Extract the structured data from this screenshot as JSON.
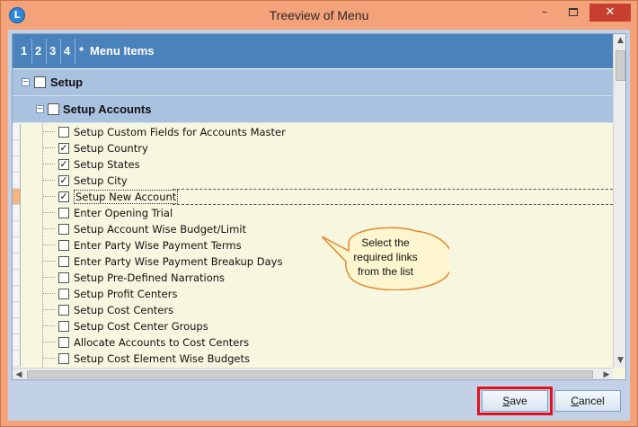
{
  "window": {
    "title": "Treeview of Menu",
    "app_icon": "L",
    "minimize": "–",
    "close": "✕"
  },
  "header": {
    "levels": [
      "1",
      "2",
      "3",
      "4"
    ],
    "star": "*",
    "menu_items": "Menu Items"
  },
  "tree": {
    "root": {
      "label": "Setup",
      "expander": "–"
    },
    "group": {
      "label": "Setup Accounts",
      "expander": "–"
    },
    "items": [
      {
        "label": "Setup Custom Fields for Accounts Master",
        "checked": ""
      },
      {
        "label": "Setup Country",
        "checked": "✓"
      },
      {
        "label": "Setup States",
        "checked": "✓"
      },
      {
        "label": "Setup City",
        "checked": "✓"
      },
      {
        "label": "Setup New Account",
        "checked": "✓"
      },
      {
        "label": "Enter Opening Trial",
        "checked": ""
      },
      {
        "label": "Setup Account Wise Budget/Limit",
        "checked": ""
      },
      {
        "label": "Enter Party Wise Payment Terms",
        "checked": ""
      },
      {
        "label": "Enter Party Wise Payment Breakup Days",
        "checked": ""
      },
      {
        "label": "Setup Pre-Defined Narrations",
        "checked": ""
      },
      {
        "label": "Setup Profit Centers",
        "checked": ""
      },
      {
        "label": "Setup Cost Centers",
        "checked": ""
      },
      {
        "label": "Setup Cost Center Groups",
        "checked": ""
      },
      {
        "label": "Allocate Accounts to Cost Centers",
        "checked": ""
      },
      {
        "label": "Setup Cost Element Wise Budgets",
        "checked": ""
      }
    ]
  },
  "callout": {
    "line1": "Select the",
    "line2": "required links",
    "line3": "from the list"
  },
  "scroll": {
    "up": "▲",
    "down": "▼",
    "left": "◀",
    "right": "▶"
  },
  "buttons": {
    "save_first": "S",
    "save_rest": "ave",
    "cancel_first": "C",
    "cancel_rest": "ancel"
  },
  "colors": {
    "frame": "#f4a27a",
    "header": "#4a83bc",
    "group_row": "#a9c2e0",
    "tree_bg": "#f7f6df",
    "highlight": "#e3101a"
  }
}
